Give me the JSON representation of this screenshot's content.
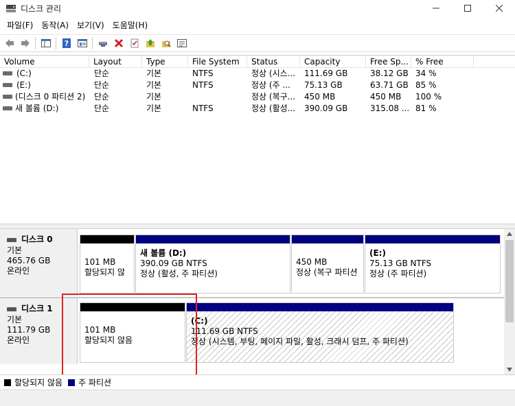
{
  "window": {
    "title": "디스크 관리",
    "min_glyph": "—",
    "max_glyph": "☐",
    "close_glyph": "✕"
  },
  "menu": [
    "파일(F)",
    "동작(A)",
    "보기(V)",
    "도움말(H)"
  ],
  "toolbar_icons": [
    "back-arrow-icon",
    "forward-arrow-icon",
    "console-tree-icon",
    "help-icon",
    "properties-icon",
    "connect-drive-icon",
    "delete-icon",
    "checklist-icon",
    "up-folder-icon",
    "search-folder-icon",
    "settings-list-icon"
  ],
  "volume_list": {
    "columns": [
      "Volume",
      "Layout",
      "Type",
      "File System",
      "Status",
      "Capacity",
      "Free Sp...",
      "% Free"
    ],
    "rows": [
      {
        "volume": "(C:)",
        "layout": "단순",
        "type": "기본",
        "fs": "NTFS",
        "status": "정상 (시스...",
        "capacity": "111.69 GB",
        "free": "38.12 GB",
        "pct": "34 %"
      },
      {
        "volume": "(E:)",
        "layout": "단순",
        "type": "기본",
        "fs": "NTFS",
        "status": "정상 (주 ...",
        "capacity": "75.13 GB",
        "free": "63.71 GB",
        "pct": "85 %"
      },
      {
        "volume": "(디스크 0 파티션 2)",
        "layout": "단순",
        "type": "기본",
        "fs": "",
        "status": "정상 (복구...",
        "capacity": "450 MB",
        "free": "450 MB",
        "pct": "100 %"
      },
      {
        "volume": "새 볼륨 (D:)",
        "layout": "단순",
        "type": "기본",
        "fs": "NTFS",
        "status": "정상 (활성...",
        "capacity": "390.09 GB",
        "free": "315.08 ...",
        "pct": "81 %"
      }
    ]
  },
  "disks": [
    {
      "name": "디스크 0",
      "type": "기본",
      "size": "465.76 GB",
      "state": "온라인",
      "partitions": [
        {
          "name": "",
          "size": "101 MB",
          "status": "할당되지 않",
          "kind": "unallocated"
        },
        {
          "name": "새 볼륨  (D:)",
          "size": "390.09 GB NTFS",
          "status": "정상 (활성, 주 파티션)",
          "kind": "primary"
        },
        {
          "name": "",
          "size": "450 MB",
          "status": "정상 (복구 파티션",
          "kind": "primary"
        },
        {
          "name": "(E:)",
          "size": "75.13 GB NTFS",
          "status": "정상 (주 파티션)",
          "kind": "primary"
        }
      ]
    },
    {
      "name": "디스크 1",
      "type": "기본",
      "size": "111.79 GB",
      "state": "온라인",
      "partitions": [
        {
          "name": "",
          "size": "101 MB",
          "status": "할당되지 않음",
          "kind": "unallocated"
        },
        {
          "name": "(C:)",
          "size": "111.69 GB NTFS",
          "status": "정상 (시스템, 부팅, 페이지 파일, 활성, 크래시 덤프, 주 파티션)",
          "kind": "primary"
        }
      ]
    }
  ],
  "legend": [
    {
      "label": "할당되지 않음",
      "color": "#000000"
    },
    {
      "label": "주 파티션",
      "color": "#000080"
    }
  ],
  "colors": {
    "unallocated": "#000000",
    "primary": "#000080",
    "highlight": "#e02020"
  }
}
